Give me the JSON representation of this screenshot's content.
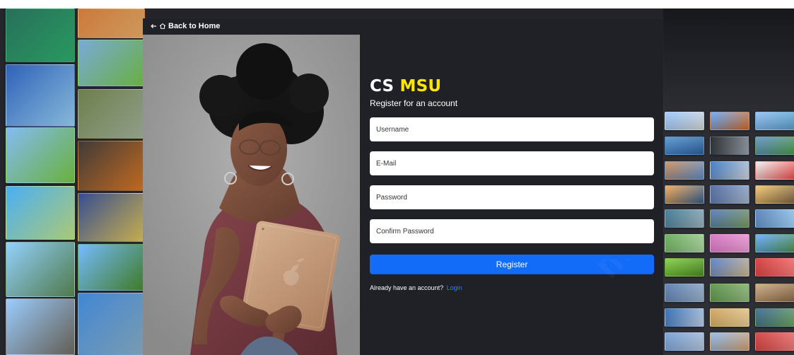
{
  "navigation": {
    "back_label": "Back to Home",
    "back_icon": "arrow-left-icon",
    "home_icon": "home-icon"
  },
  "hero": {
    "image_icon": "portrait-photo"
  },
  "brand": {
    "cs": "CS",
    "msu": "MSU"
  },
  "register": {
    "subtitle": "Register for an account",
    "username_placeholder": "Username",
    "email_placeholder": "E-Mail",
    "password_placeholder": "Password",
    "confirm_password_placeholder": "Confirm Password",
    "button_label": "Register",
    "login_prompt": "Already have an account?",
    "login_link": "Login"
  },
  "colors": {
    "panel": "#1f2127",
    "accent": "#136cf8",
    "brand_highlight": "#ffe600",
    "text": "#ffffff"
  }
}
